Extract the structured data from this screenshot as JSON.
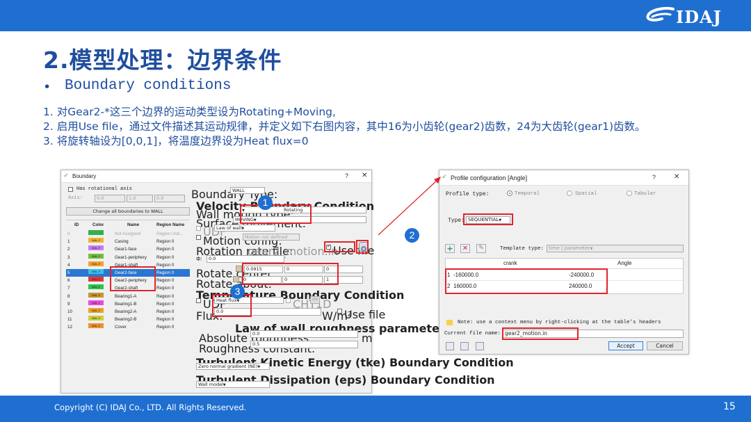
{
  "slide": {
    "logo_text": "IDAJ",
    "title": "2.模型处理：边界条件",
    "bullet": "•",
    "subtitle": "Boundary conditions",
    "steps": [
      "1.  对Gear2-*这三个边界的运动类型设为Rotating+Moving,",
      "2.  启用Use file，通过文件描述其运动规律，并定义如下右图内容，其中16为小齿轮(gear2)齿数，24为大齿轮(gear1)齿数。",
      "3.  将旋转轴设为[0,0,1]，将温度边界设为Heat flux=0"
    ],
    "copyright": "Copyright (C)  IDAJ Co., LTD. All Rights Reserved.",
    "page_number": "15",
    "markers": [
      "1",
      "2",
      "3"
    ],
    "accent_color": "#1f6fd1",
    "title_color": "#1f4e9e",
    "highlight_color": "#e0242c"
  },
  "boundary_dialog": {
    "title": "Boundary",
    "help": "?",
    "close": "✕",
    "has_rotational_axis": "Has rotational axis",
    "axis_label": "Axis:",
    "axis_values": [
      "0.0",
      "1.0",
      "0.0"
    ],
    "change_all": "Change all boundaries to WALL",
    "table_headers": [
      "ID",
      "Color",
      "Name",
      "Region Name"
    ],
    "rows": [
      {
        "id": "0",
        "tag": "",
        "name": "Not Assigned",
        "region": "Region Und..."
      },
      {
        "id": "1",
        "tag": "WAL-F",
        "name": "Casing",
        "region": "Region 0"
      },
      {
        "id": "2",
        "tag": "WAL-F",
        "name": "Gear1-face",
        "region": "Region 0"
      },
      {
        "id": "3",
        "tag": "WAL-F",
        "name": "Gear1-periphery",
        "region": "Region 0"
      },
      {
        "id": "4",
        "tag": "WAL-F",
        "name": "Gear1-shaft",
        "region": "Region 0"
      },
      {
        "id": "5",
        "tag": "WAL-F",
        "name": "Gear2-face",
        "region": "Region 0"
      },
      {
        "id": "6",
        "tag": "WAL-F",
        "name": "Gear2-periphery",
        "region": "Region 0"
      },
      {
        "id": "7",
        "tag": "WAL-F",
        "name": "Gear2-shaft",
        "region": "Region 0"
      },
      {
        "id": "8",
        "tag": "WAL-F",
        "name": "Bearing1-A",
        "region": "Region 0"
      },
      {
        "id": "9",
        "tag": "WAL-F",
        "name": "Bearing1-B",
        "region": "Region 0"
      },
      {
        "id": "10",
        "tag": "WAL-F",
        "name": "Bearing2-A",
        "region": "Region 0"
      },
      {
        "id": "11",
        "tag": "WAL-F",
        "name": "Bearing2-B",
        "region": "Region 0"
      },
      {
        "id": "12",
        "tag": "WAL-F",
        "name": "Cover",
        "region": "Region 0"
      }
    ],
    "row_colors": [
      "#2fb24a",
      "#f2b233",
      "#c77cf0",
      "#6fbf3f",
      "#f0a030",
      "#3ec0e8",
      "#e03a3a",
      "#2fc24f",
      "#c79430",
      "#e84ae0",
      "#e8a030",
      "#c8d040",
      "#f09030"
    ],
    "boundary_type_label": "Boundary Type:",
    "boundary_type_value": "WALL",
    "velocity_header": "Velocity Boundary Condition",
    "wall_motion_label": "Wall motion type:",
    "wall_motion_value": "Rotating",
    "surface_movement_label": "Surface movement:",
    "surface_movement_value": "MOVING",
    "udf_label": "UDF",
    "law_of_wall": "Law of wall",
    "motion_config_label": "Motion config:",
    "motion_config_value": "Motion not defined",
    "rotation_file_label": "Rotation rate file:",
    "rotation_file_value": "gear2_motion.in",
    "use_file_label": "Use file",
    "phi_label": "Φ:",
    "phi_value": "0.0",
    "rotate_center_label": "Rotate center:",
    "rotate_center_values": [
      "0.0915",
      "0",
      "0"
    ],
    "rotate_about_label": "Rotate about:",
    "rotate_about_values": [
      "0",
      "0",
      "1"
    ],
    "temperature_header": "Temperature Boundary Condition",
    "temp_udf_label": "UDF",
    "heat_flux_value": "Heat flux",
    "cht1d_label": "CHT1D",
    "flux_label": "Flux:",
    "flux_value": "0.0",
    "flux_unit": "W/m²",
    "flux_use_file": "Use file",
    "roughness_header": "Law of wall roughness parameters",
    "abs_roughness_label": "Absolute roughness:",
    "abs_roughness_value": "0.0",
    "abs_roughness_unit": "m",
    "roughness_constant_label": "Roughness constant:",
    "roughness_constant_value": "0.5",
    "tke_header": "Turbulent Kinetic Energy (tke) Boundary Condition",
    "tke_value": "Zero normal gradient (NE)",
    "eps_header": "Turbulent Dissipation (eps) Boundary Condition",
    "eps_value": "Wall model"
  },
  "profile_dialog": {
    "title": "Profile configuration [Angle]",
    "help": "?",
    "close": "✕",
    "profile_type_label": "Profile type:",
    "profile_options": [
      "Temporal",
      "Spatial",
      "Tabular"
    ],
    "type_label": "Type:",
    "type_value": "SEQUENTIAL",
    "template_type_label": "Template type:",
    "template_type_value": "time | parameter",
    "columns": [
      "crank",
      "Angle"
    ],
    "rows": [
      {
        "idx": "1",
        "crank": "-160000.0",
        "angle": "-240000.0"
      },
      {
        "idx": "2",
        "crank": "160000.0",
        "angle": "240000.0"
      }
    ],
    "note": "Note: use a context menu by right-clicking at the table's headers",
    "current_file_label": "Current file name:",
    "current_file_value": "gear2_motion.in",
    "accept": "Accept",
    "cancel": "Cancel",
    "toolbar_icons": [
      "add-icon",
      "delete-icon",
      "clear-icon"
    ],
    "file_icons": [
      "import-icon",
      "open-icon",
      "image-icon"
    ]
  }
}
